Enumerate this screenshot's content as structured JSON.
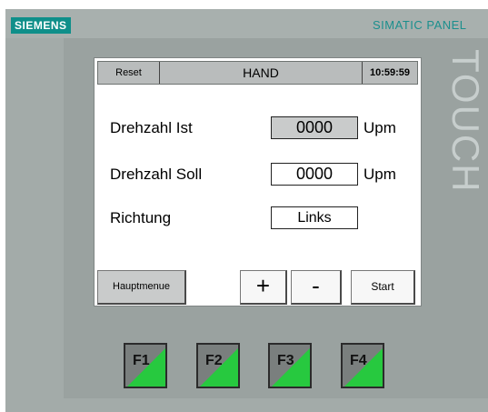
{
  "brand": {
    "logo": "SIEMENS",
    "panel_name": "SIMATIC PANEL",
    "touch_label": "TOUCH"
  },
  "header": {
    "reset_label": "Reset",
    "mode_label": "HAND",
    "clock": "10:59:59"
  },
  "rows": [
    {
      "label": "Drehzahl Ist",
      "value": "0000",
      "unit": "Upm"
    },
    {
      "label": "Drehzahl Soll",
      "value": "0000",
      "unit": "Upm"
    },
    {
      "label": "Richtung",
      "value": "Links"
    }
  ],
  "buttons": {
    "hauptmenue": "Hauptmenue",
    "plus": "+",
    "minus": "-",
    "start": "Start"
  },
  "function_keys": [
    "F1",
    "F2",
    "F3",
    "F4"
  ],
  "colors": {
    "brand_teal": "#0f8f8a",
    "panel_gray": "#9aa2a0",
    "fkey_green": "#27c93f"
  }
}
